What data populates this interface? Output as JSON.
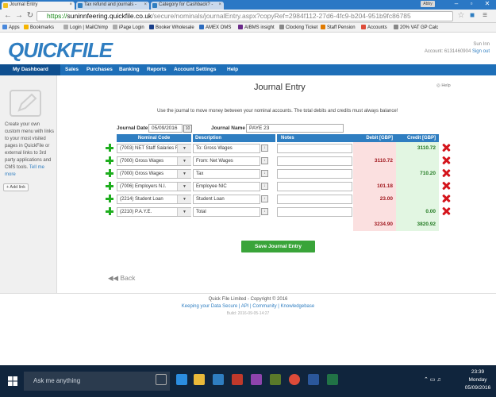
{
  "browser": {
    "tabs": [
      {
        "label": "Journal Entry",
        "color": "#f0c020"
      },
      {
        "label": "Tax refund and journals -",
        "color": "#2f7ec1"
      },
      {
        "label": "Category for Cashback? -",
        "color": "#2f7ec1"
      }
    ],
    "url": {
      "scheme": "https://",
      "host": "suninnfeering.quickfile.co.uk",
      "path": "/secure/nominals/journalEntry.aspx?copyRef=2984f112-27d6-4fc9-b204-951b9fc86785"
    },
    "bookmarks": [
      {
        "label": "Apps",
        "icon": "apps-grid-icon",
        "color": "#4a89dc"
      },
      {
        "label": "Bookmarks",
        "icon": "star-icon",
        "color": "#f5b400"
      },
      {
        "label": "Login | MailChimp",
        "icon": "page-icon",
        "color": "#aaa"
      },
      {
        "label": "iPage Login",
        "icon": "page-icon",
        "color": "#aaa"
      },
      {
        "label": "Booker Wholesale",
        "icon": "b-icon",
        "color": "#1a3f8a"
      },
      {
        "label": "AMEX OMS",
        "icon": "amex-icon",
        "color": "#2c6cbf"
      },
      {
        "label": "AIBMS insight",
        "icon": "aib-icon",
        "color": "#6a2a8a"
      },
      {
        "label": "Clocking Ticket",
        "icon": "page-icon",
        "color": "#888"
      },
      {
        "label": "Staff Pension",
        "icon": "pension-icon",
        "color": "#e07a00"
      },
      {
        "label": "Accounts",
        "icon": "g-icon",
        "color": "#dd4b39"
      },
      {
        "label": "20% VAT GP Calc",
        "icon": "page-icon",
        "color": "#888"
      }
    ]
  },
  "header": {
    "logo": "QUICKFILE",
    "user_name": "Sun Inn",
    "account": "Account: 6131460904",
    "sign_out": "Sign out"
  },
  "menu": [
    "My Dashboard",
    "Sales",
    "Purchases",
    "Banking",
    "Reports",
    "Account Settings",
    "Help"
  ],
  "sidebar": {
    "text": "Create your own custom menu with links to your most visited pages in QuickFile or external links to 3rd party applications and CMS tools.",
    "link": "Tell me more",
    "add_link": "+ Add link"
  },
  "main": {
    "title": "Journal Entry",
    "help": "Help",
    "intro": "Use the journal to move money between your nominal accounts. The total debits and credits must always balance!",
    "journal_date_label": "Journal Date :",
    "journal_date": "05/09/2016",
    "cal_day": "10",
    "journal_name_label": "Journal Name :",
    "journal_name": "PAYE 23",
    "columns": {
      "code": "Nominal Code",
      "desc": "Description",
      "notes": "Notes",
      "debit": "Debit [GBP]",
      "credit": "Credit [GBP]"
    },
    "rows": [
      {
        "code": "(7003) NET Staff Salaries F",
        "desc": "To: Gross Wages",
        "debit": "",
        "credit": "3110.72"
      },
      {
        "code": "(7000) Gross Wages",
        "desc": "From: Net Wages",
        "debit": "3110.72",
        "credit": ""
      },
      {
        "code": "(7000) Gross Wages",
        "desc": "Tax",
        "debit": "",
        "credit": "710.20"
      },
      {
        "code": "(7006) Employers N.I.",
        "desc": "Employee NIC",
        "debit": "101.18",
        "credit": ""
      },
      {
        "code": "(2214) Student Loan",
        "desc": "Student Loan",
        "debit": "23.00",
        "credit": ""
      },
      {
        "code": "(2210) P.A.Y.E.",
        "desc": "Total",
        "debit": "",
        "credit": "0.00"
      }
    ],
    "total_debit": "3234.90",
    "total_credit": "3820.92",
    "save": "Save Journal Entry",
    "back": "Back"
  },
  "footer": {
    "copyright": "Quick File Limited - Copyright © 2016",
    "links": "Keeping your Data Secure | API | Community | Knowledgebase",
    "build": "Build: 2016-09-05-14:27"
  },
  "taskbar": {
    "search": "Ask me anything",
    "time": "23:39",
    "day": "Monday",
    "date": "05/09/2016"
  },
  "colors": {
    "brand": "#2f7ec1",
    "menu": "#1e6fb8",
    "debit_bg": "#fbe0e0",
    "credit_bg": "#e2f6e2",
    "save": "#39a439",
    "delete": "#d4141b"
  }
}
